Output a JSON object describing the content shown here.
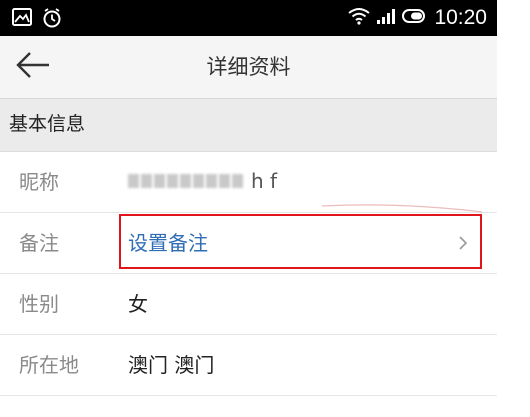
{
  "statusbar": {
    "time": "10:20",
    "left_icons": [
      "image-icon",
      "alarm-clock-icon"
    ],
    "right_icons": [
      "wifi-icon",
      "signal-icon",
      "battery-icon"
    ]
  },
  "header": {
    "title": "详细资料",
    "back_icon": "back-arrow-icon"
  },
  "section": {
    "title": "基本信息"
  },
  "rows": [
    {
      "label": "昵称",
      "value_tail": "h f"
    },
    {
      "label": "备注",
      "value": "设置备注",
      "chevron_icon": "chevron-right-icon"
    },
    {
      "label": "性别",
      "value": "女"
    },
    {
      "label": "所在地",
      "value": "澳门 澳门"
    }
  ],
  "colors": {
    "statusbar_bg": "#000000",
    "titlebar_bg": "#f5f5f5",
    "section_bg": "#ebebeb",
    "link": "#2f6db5",
    "highlight": "#e0141b",
    "label": "#8a8a8a"
  }
}
